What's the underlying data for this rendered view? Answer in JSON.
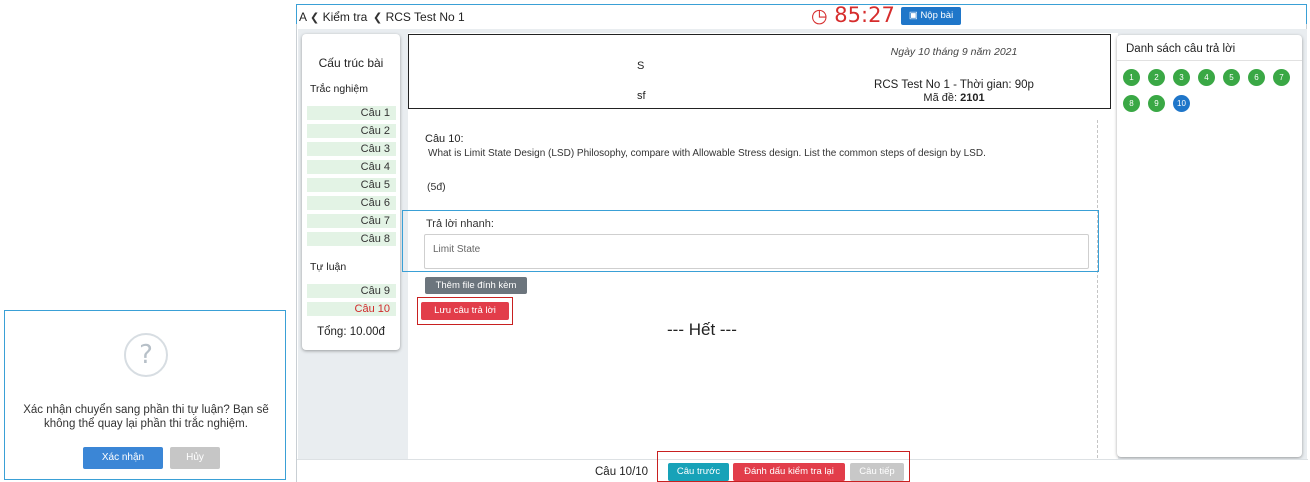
{
  "dialog": {
    "icon": "question-icon",
    "message_line1": "Xác nhận chuyển sang phần thi tự luận? Bạn sẽ",
    "message_line2": "không thể quay lại phần thi trắc nghiệm.",
    "confirm_label": "Xác nhận",
    "cancel_label": "Hủy"
  },
  "topbar": {
    "crumb_fragment": "A",
    "crumb1": "Kiểm tra",
    "crumb2": "RCS Test No 1",
    "timer": "85:27",
    "submit_label": "Nộp bài"
  },
  "structure": {
    "title": "Cấu trúc bài",
    "mcq_section": "Trắc nghiệm",
    "mcq_items": [
      "Câu 1",
      "Câu 2",
      "Câu 3",
      "Câu 4",
      "Câu 5",
      "Câu 6",
      "Câu 7",
      "Câu 8"
    ],
    "essay_section": "Tự luận",
    "essay_items": [
      "Câu 9",
      "Câu 10"
    ],
    "active_item": "Câu 10",
    "total": "Tổng: 10.00đ"
  },
  "header": {
    "date": "Ngày 10 tháng 9 năm 2021",
    "title": "RCS Test No 1 - Thời gian: 90p",
    "code_label": "Mã đề:",
    "code_value": "2101",
    "fragment1": "S",
    "fragment2": "sf"
  },
  "question": {
    "number": "Câu 10:",
    "text": "What is Limit State Design (LSD) Philosophy, compare with Allowable Stress design. List the common steps of design by LSD.",
    "points": "(5đ)"
  },
  "answer": {
    "label": "Trả lời nhanh:",
    "value": "Limit State",
    "attach_label": "Thêm file đính kèm",
    "save_label": "Lưu câu trả lời"
  },
  "end_text": "--- Hết ---",
  "answers_panel": {
    "title": "Danh sách câu trả lời",
    "items": [
      "1",
      "2",
      "3",
      "4",
      "5",
      "6",
      "7",
      "8",
      "9",
      "10"
    ],
    "current": "10",
    "colors": {
      "answered": "#3aa845",
      "current": "#1f76c9"
    }
  },
  "footer": {
    "count": "Câu 10/10",
    "prev_label": "Câu trước",
    "mark_label": "Đánh dấu kiểm tra lại",
    "next_label": "Câu tiếp"
  }
}
